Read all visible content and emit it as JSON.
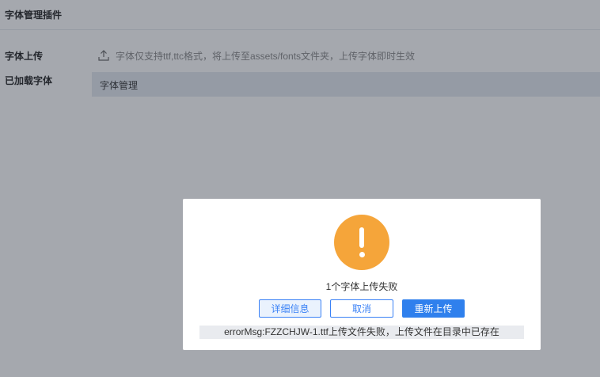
{
  "header": {
    "title": "字体管理插件"
  },
  "upload": {
    "label": "字体上传",
    "icon": "upload-icon",
    "hint": "字体仅支持ttf,ttc格式，将上传至assets/fonts文件夹，上传字体即时生效"
  },
  "loaded": {
    "label": "已加载字体",
    "tab_label": "字体管理"
  },
  "dialog": {
    "icon": "warning-icon",
    "icon_color": "#f5a53a",
    "message": "1个字体上传失败",
    "buttons": {
      "detail": "详细信息",
      "cancel": "取消",
      "reupload": "重新上传"
    },
    "error_text": "errorMsg:FZZCHJW-1.ttf上传文件失败，上传文件在目录中已存在"
  },
  "colors": {
    "primary": "#2f80ed",
    "warning": "#f5a53a",
    "overlay": "rgba(40,48,62,0.42)"
  }
}
